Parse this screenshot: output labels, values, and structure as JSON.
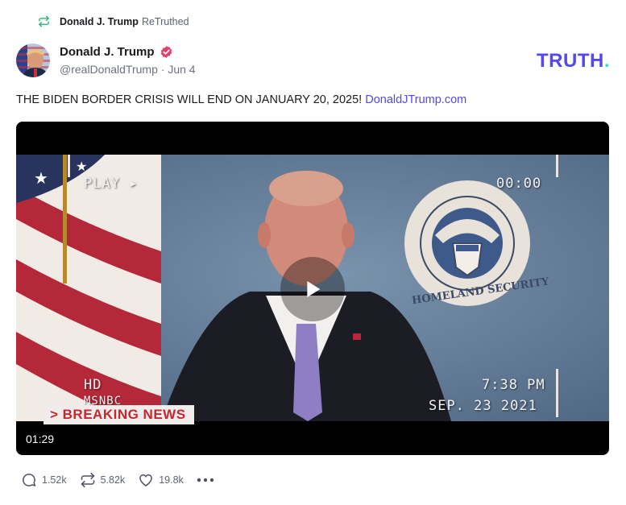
{
  "retruth": {
    "name": "Donald J. Trump",
    "label": "ReTruthed",
    "icon": "retruth-icon"
  },
  "post": {
    "author_name": "Donald J. Trump",
    "verified_icon": "verified-badge-icon",
    "handle": "@realDonaldTrump",
    "separator": "·",
    "date": "Jun 4",
    "text": "THE BIDEN BORDER CRISIS WILL END ON JANUARY 20, 2025!",
    "link": "DonaldJTrump.com"
  },
  "brand": {
    "logo_main": "TRUTH",
    "logo_dot": ".",
    "primary_color": "#5448ee",
    "accent_color": "#2ee0c3"
  },
  "video": {
    "play_overlay": "PLAY ▸",
    "timestamp_top": "00:00",
    "time_overlay": "7:38 PM",
    "date_overlay": "SEP. 23 2021",
    "hd_overlay": "HD",
    "msnbc_overlay": "MSNBC",
    "breaking": "> BREAKING NEWS",
    "seal_text_top": "U.S. DEPARTMENT OF",
    "seal_text_bottom": "HOMELAND SECURITY",
    "duration": "01:29",
    "play_icon": "play-icon"
  },
  "actions": {
    "replies": "1.52k",
    "retruths": "5.82k",
    "likes": "19.8k",
    "reply_icon": "reply-icon",
    "retruth_icon": "retruth-icon",
    "like_icon": "heart-icon",
    "more_icon": "more-icon"
  }
}
